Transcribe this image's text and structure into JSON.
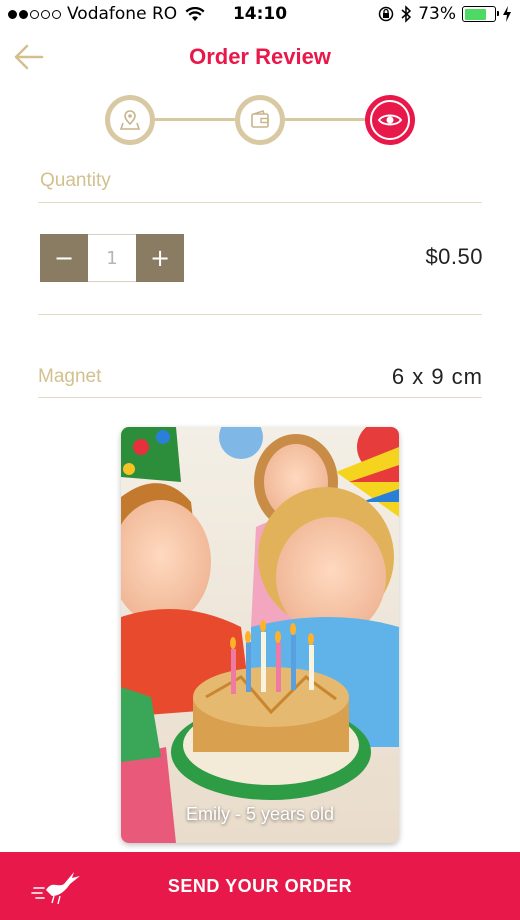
{
  "status_bar": {
    "carrier": "Vodafone RO",
    "time": "14:10",
    "battery": "73%",
    "battery_level": 0.73
  },
  "header": {
    "title": "Order Review"
  },
  "steps": [
    {
      "icon": "location-icon",
      "state": "done"
    },
    {
      "icon": "wallet-icon",
      "state": "done"
    },
    {
      "icon": "eye-icon",
      "state": "active"
    }
  ],
  "quantity": {
    "label": "Quantity",
    "minus": "−",
    "value": "1",
    "plus": "+",
    "price": "$0.50"
  },
  "product": {
    "label": "Magnet",
    "size": "6 x 9 cm"
  },
  "photo": {
    "caption": "Emily - 5 years old"
  },
  "footer": {
    "send_label": "SEND YOUR ORDER"
  },
  "colors": {
    "accent": "#e8184a",
    "gold": "#d3c08f",
    "stepper_button": "#8a7c63"
  }
}
